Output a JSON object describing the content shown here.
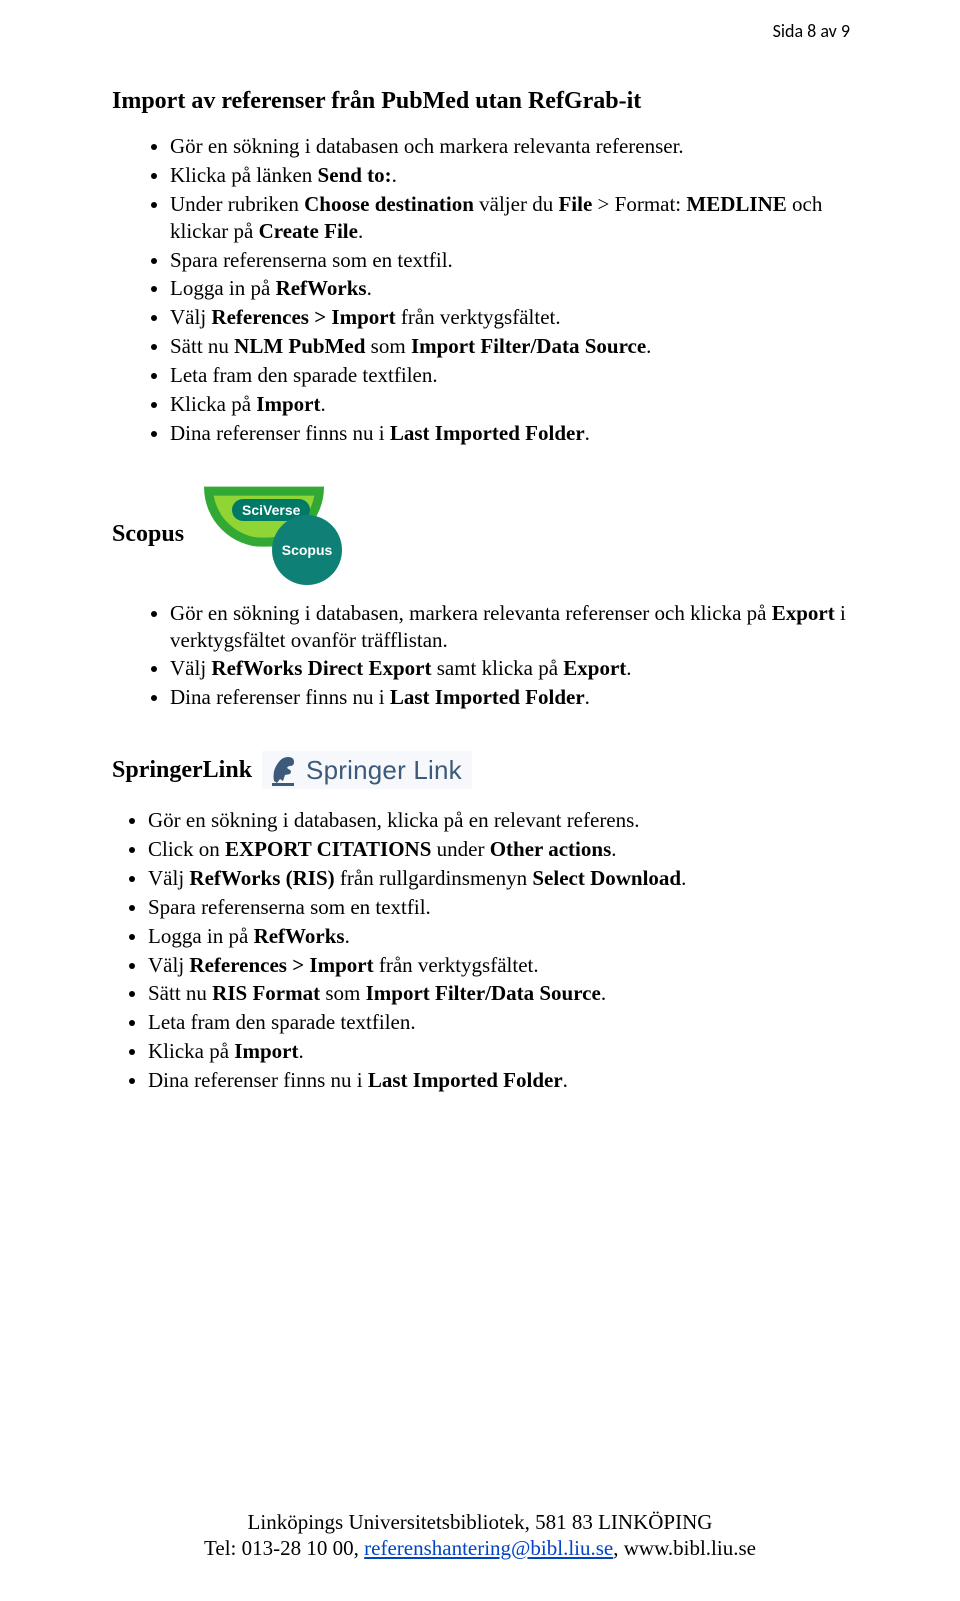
{
  "header": {
    "text": "Sida 8 av 9"
  },
  "section1": {
    "title": "Import av referenser från PubMed utan RefGrab-it",
    "items": [
      {
        "pre": "Gör en sökning i databasen och markera relevanta referenser."
      },
      {
        "pre": "Klicka på länken ",
        "b1": "Send to:",
        "post": "."
      },
      {
        "pre": "Under rubriken ",
        "b1": "Choose destination",
        "mid1": " väljer du ",
        "b2": "File",
        "mid2": " > Format: ",
        "b3": "MEDLINE",
        "mid3": " och klickar på ",
        "b4": "Create File",
        "post": "."
      },
      {
        "pre": "Spara referenserna som en textfil."
      },
      {
        "pre": "Logga in på ",
        "b1": "RefWorks",
        "post": "."
      },
      {
        "pre": "Välj ",
        "b1": "References > Import",
        "post": " från verktygsfältet."
      },
      {
        "pre": "Sätt nu ",
        "b1": "NLM PubMed",
        "mid1": " som ",
        "b2": "Import Filter/Data Source",
        "post": "."
      },
      {
        "pre": "Leta fram den sparade textfilen."
      },
      {
        "pre": "Klicka på ",
        "b1": "Import",
        "post": "."
      },
      {
        "pre": "Dina referenser finns nu i ",
        "b1": "Last Imported Folder",
        "post": "."
      }
    ]
  },
  "section2": {
    "title": "Scopus",
    "logo": {
      "badge": "SciVerse",
      "circle": "Scopus"
    },
    "items": [
      {
        "pre": "Gör en sökning i databasen, markera relevanta referenser och klicka på ",
        "b1": "Export",
        "post": " i verktygsfältet ovanför träfflistan."
      },
      {
        "pre": "Välj ",
        "b1": "RefWorks Direct Export",
        "mid1": " samt klicka på ",
        "b2": "Export",
        "post": "."
      },
      {
        "pre": "Dina referenser finns nu i ",
        "b1": "Last Imported Folder",
        "post": "."
      }
    ]
  },
  "section3": {
    "title": "SpringerLink",
    "logo_text1": "Springer",
    "logo_text2": " Link",
    "items": [
      {
        "pre": "Gör en sökning i databasen, klicka på en relevant referens."
      },
      {
        "pre": "Click on ",
        "b1": "EXPORT CITATIONS",
        "mid1": " under ",
        "b2": "Other actions",
        "post": "."
      },
      {
        "pre": "Välj ",
        "b1": "RefWorks (RIS)",
        "mid1": " från rullgardinsmenyn ",
        "b2": "Select Download",
        "post": "."
      },
      {
        "pre": "Spara referenserna som en textfil."
      },
      {
        "pre": "Logga in på ",
        "b1": "RefWorks",
        "post": "."
      },
      {
        "pre": "Välj ",
        "b1": "References > Import",
        "post": " från verktygsfältet."
      },
      {
        "pre": "Sätt nu ",
        "b1": "RIS Format",
        "mid1": " som ",
        "b2": "Import Filter/Data Source",
        "post": "."
      },
      {
        "pre": "Leta fram den sparade textfilen."
      },
      {
        "pre": "Klicka på ",
        "b1": "Import",
        "post": "."
      },
      {
        "pre": "Dina referenser finns nu i ",
        "b1": "Last Imported Folder",
        "post": "."
      }
    ]
  },
  "footer": {
    "line1": "Linköpings Universitetsbibliotek, 581 83 LINKÖPING",
    "line2_pre": "Tel: 013-28 10 00, ",
    "line2_link": "referenshantering@bibl.liu.se",
    "line2_post": ", www.bibl.liu.se"
  }
}
